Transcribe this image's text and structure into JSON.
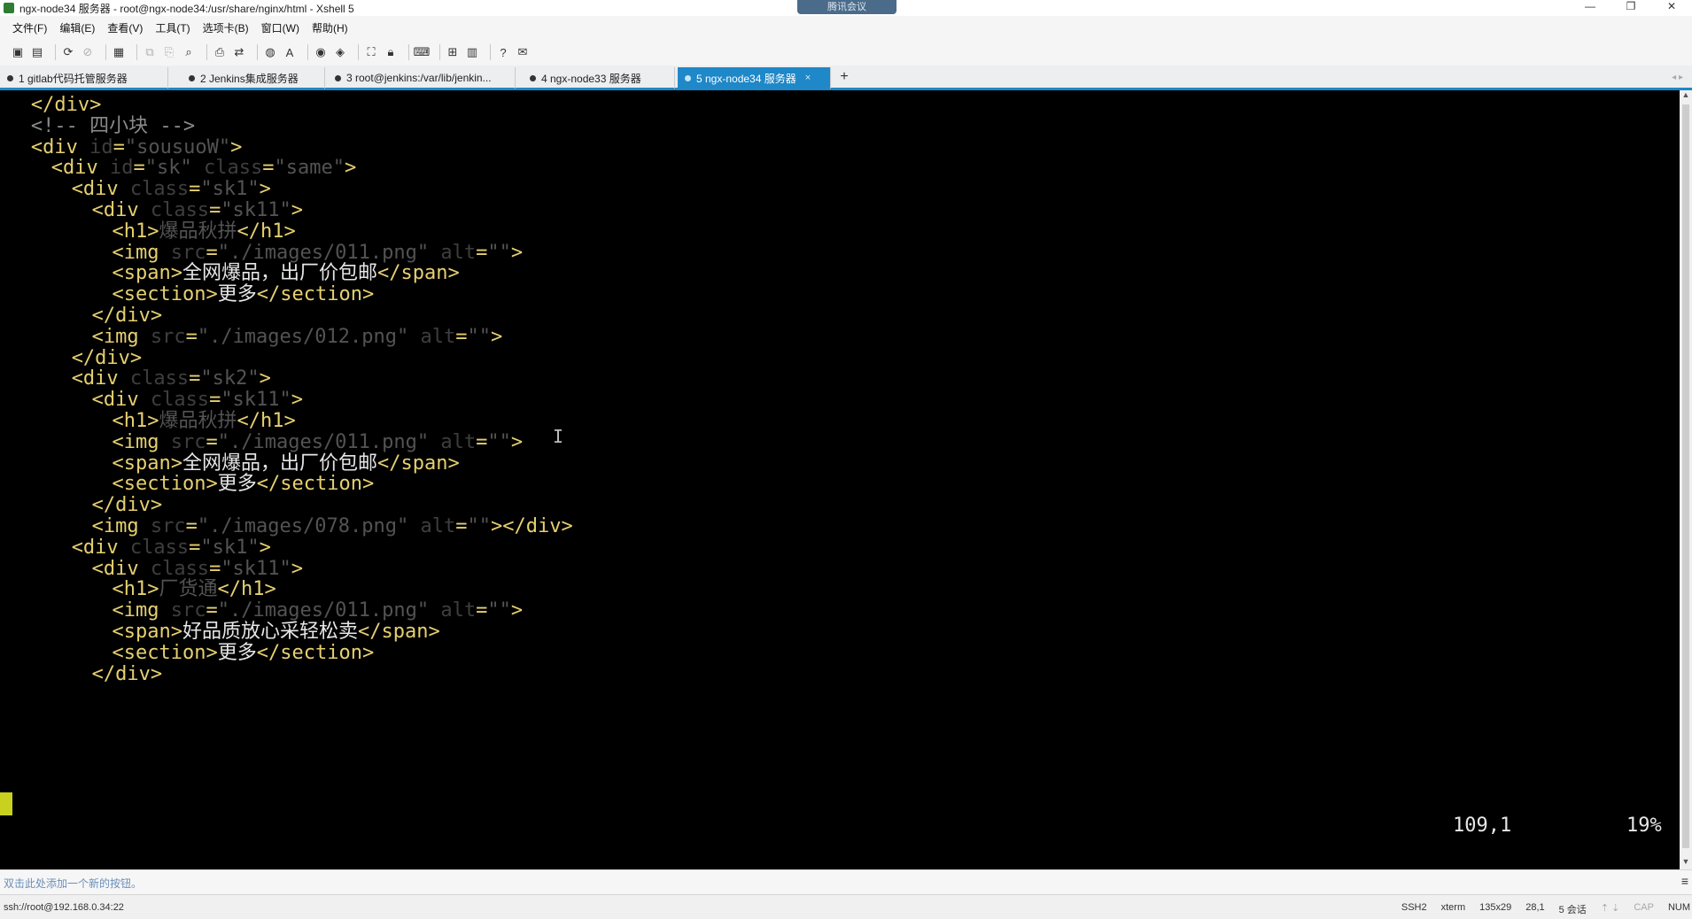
{
  "window": {
    "title": "ngx-node34 服务器 - root@ngx-node34:/usr/share/nginx/html - Xshell 5",
    "badge": "腾讯会议",
    "controls": [
      "—",
      "❐",
      "✕"
    ]
  },
  "menu": [
    "文件(F)",
    "编辑(E)",
    "查看(V)",
    "工具(T)",
    "选项卡(B)",
    "窗口(W)",
    "帮助(H)"
  ],
  "tabs": [
    {
      "label": "1 gitlab代码托管服务器",
      "active": false
    },
    {
      "label": "2 Jenkins集成服务器",
      "active": false
    },
    {
      "label": "3 root@jenkins:/var/lib/jenkin...",
      "active": false
    },
    {
      "label": "4 ngx-node33 服务器",
      "active": false
    },
    {
      "label": "5 ngx-node34 服务器",
      "active": true
    }
  ],
  "tab_close": "×",
  "tab_add": "+",
  "terminal": {
    "lines": [
      {
        "indent": 2,
        "segs": [
          [
            "t",
            "</div>"
          ]
        ]
      },
      {
        "indent": 2,
        "segs": [
          [
            "cm",
            "<!-- 四小块 -->"
          ]
        ]
      },
      {
        "indent": 2,
        "segs": [
          [
            "t",
            "<div "
          ],
          [
            "a",
            "id"
          ],
          [
            "t",
            "="
          ],
          [
            "s",
            "\"sousuoW\""
          ],
          [
            "t",
            ">"
          ]
        ]
      },
      {
        "indent": 4,
        "segs": [
          [
            "t",
            "<div "
          ],
          [
            "a",
            "id"
          ],
          [
            "t",
            "="
          ],
          [
            "s",
            "\"sk\""
          ],
          [
            "t",
            " "
          ],
          [
            "a",
            "class"
          ],
          [
            "t",
            "="
          ],
          [
            "s",
            "\"same\""
          ],
          [
            "t",
            ">"
          ]
        ]
      },
      {
        "indent": 6,
        "segs": [
          [
            "t",
            "<div "
          ],
          [
            "a",
            "class"
          ],
          [
            "t",
            "="
          ],
          [
            "s",
            "\"sk1\""
          ],
          [
            "t",
            ">"
          ]
        ]
      },
      {
        "indent": 8,
        "segs": [
          [
            "t",
            "<div "
          ],
          [
            "a",
            "class"
          ],
          [
            "t",
            "="
          ],
          [
            "s",
            "\"sk11\""
          ],
          [
            "t",
            ">"
          ]
        ]
      },
      {
        "indent": 10,
        "segs": [
          [
            "t",
            "<h1>"
          ],
          [
            "s",
            "爆品秋拼"
          ],
          [
            "t",
            "</h1>"
          ]
        ]
      },
      {
        "indent": 10,
        "segs": [
          [
            "t",
            "<img "
          ],
          [
            "a",
            "src"
          ],
          [
            "t",
            "="
          ],
          [
            "s",
            "\"./images/011.png\""
          ],
          [
            "t",
            " "
          ],
          [
            "a",
            "alt"
          ],
          [
            "t",
            "="
          ],
          [
            "s",
            "\"\""
          ],
          [
            "t",
            ">"
          ]
        ]
      },
      {
        "indent": 10,
        "segs": [
          [
            "t",
            "<span>"
          ],
          [
            "c",
            "全网爆品，出厂价包邮"
          ],
          [
            "t",
            "</span>"
          ]
        ]
      },
      {
        "indent": 10,
        "segs": [
          [
            "t",
            "<section>"
          ],
          [
            "c",
            "更多"
          ],
          [
            "t",
            "</section>"
          ]
        ]
      },
      {
        "indent": 8,
        "segs": [
          [
            "t",
            "</div>"
          ]
        ]
      },
      {
        "indent": 8,
        "segs": [
          [
            "t",
            "<img "
          ],
          [
            "a",
            "src"
          ],
          [
            "t",
            "="
          ],
          [
            "s",
            "\"./images/012.png\""
          ],
          [
            "t",
            " "
          ],
          [
            "a",
            "alt"
          ],
          [
            "t",
            "="
          ],
          [
            "s",
            "\"\""
          ],
          [
            "t",
            ">"
          ]
        ]
      },
      {
        "indent": 6,
        "segs": [
          [
            "t",
            "</div>"
          ]
        ]
      },
      {
        "indent": 6,
        "segs": [
          [
            "t",
            "<div "
          ],
          [
            "a",
            "class"
          ],
          [
            "t",
            "="
          ],
          [
            "s",
            "\"sk2\""
          ],
          [
            "t",
            ">"
          ]
        ]
      },
      {
        "indent": 8,
        "segs": [
          [
            "t",
            "<div "
          ],
          [
            "a",
            "class"
          ],
          [
            "t",
            "="
          ],
          [
            "s",
            "\"sk11\""
          ],
          [
            "t",
            ">"
          ]
        ]
      },
      {
        "indent": 10,
        "segs": [
          [
            "t",
            "<h1>"
          ],
          [
            "s",
            "爆品秋拼"
          ],
          [
            "t",
            "</h1>"
          ]
        ]
      },
      {
        "indent": 10,
        "segs": [
          [
            "t",
            "<img "
          ],
          [
            "a",
            "src"
          ],
          [
            "t",
            "="
          ],
          [
            "s",
            "\"./images/011.png\""
          ],
          [
            "t",
            " "
          ],
          [
            "a",
            "alt"
          ],
          [
            "t",
            "="
          ],
          [
            "s",
            "\"\""
          ],
          [
            "t",
            ">"
          ]
        ]
      },
      {
        "indent": 10,
        "segs": [
          [
            "t",
            "<span>"
          ],
          [
            "c",
            "全网爆品，出厂价包邮"
          ],
          [
            "t",
            "</span>"
          ]
        ]
      },
      {
        "indent": 10,
        "segs": [
          [
            "t",
            "<section>"
          ],
          [
            "c",
            "更多"
          ],
          [
            "t",
            "</section>"
          ]
        ]
      },
      {
        "indent": 8,
        "segs": [
          [
            "t",
            "</div>"
          ]
        ]
      },
      {
        "indent": 8,
        "segs": [
          [
            "t",
            "<img "
          ],
          [
            "a",
            "src"
          ],
          [
            "t",
            "="
          ],
          [
            "s",
            "\"./images/078.png\""
          ],
          [
            "t",
            " "
          ],
          [
            "a",
            "alt"
          ],
          [
            "t",
            "="
          ],
          [
            "s",
            "\"\""
          ],
          [
            "t",
            "></div>"
          ]
        ]
      },
      {
        "indent": 6,
        "segs": [
          [
            "t",
            "<div "
          ],
          [
            "a",
            "class"
          ],
          [
            "t",
            "="
          ],
          [
            "s",
            "\"sk1\""
          ],
          [
            "t",
            ">"
          ]
        ]
      },
      {
        "indent": 8,
        "segs": [
          [
            "t",
            "<div "
          ],
          [
            "a",
            "class"
          ],
          [
            "t",
            "="
          ],
          [
            "s",
            "\"sk11\""
          ],
          [
            "t",
            ">"
          ]
        ]
      },
      {
        "indent": 10,
        "segs": [
          [
            "t",
            "<h1>"
          ],
          [
            "s",
            "厂货通"
          ],
          [
            "t",
            "</h1>"
          ]
        ]
      },
      {
        "indent": 10,
        "segs": [
          [
            "t",
            "<img "
          ],
          [
            "a",
            "src"
          ],
          [
            "t",
            "="
          ],
          [
            "s",
            "\"./images/011.png\""
          ],
          [
            "t",
            " "
          ],
          [
            "a",
            "alt"
          ],
          [
            "t",
            "="
          ],
          [
            "s",
            "\"\""
          ],
          [
            "t",
            ">"
          ]
        ]
      },
      {
        "indent": 10,
        "segs": [
          [
            "t",
            "<span>"
          ],
          [
            "c",
            "好品质放心采轻松卖"
          ],
          [
            "t",
            "</span>"
          ]
        ]
      },
      {
        "indent": 10,
        "segs": [
          [
            "t",
            "<section>"
          ],
          [
            "c",
            "更多"
          ],
          [
            "t",
            "</section>"
          ]
        ]
      },
      {
        "indent": 8,
        "segs": [
          [
            "t",
            "</div>"
          ]
        ]
      }
    ],
    "cursor_pos": "109,1",
    "scroll_percent": "19%"
  },
  "quickbar": {
    "text": "双击此处添加一个新的按钮。",
    "menu_icon": "≡"
  },
  "status": {
    "connection": "ssh://root@192.168.0.34:22",
    "protocol": "SSH2",
    "term": "xterm",
    "size": "135x29",
    "cursor": "28,1",
    "sessions": "5 会话",
    "cap": "CAP",
    "num": "NUM"
  },
  "colors": {
    "tag": "#e6d070",
    "attr": "#3e3e3e",
    "string": "#535353",
    "text": "#e6e6e6",
    "tab_active": "#1e88c8",
    "cursor": "#c8d21e"
  }
}
